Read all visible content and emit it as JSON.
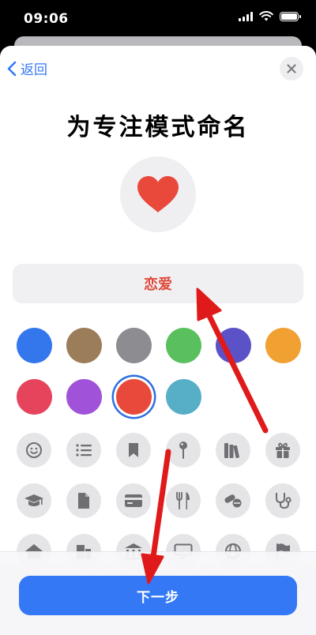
{
  "status_bar": {
    "time": "09:06"
  },
  "nav": {
    "back_label": "返回"
  },
  "title": "为专注模式命名",
  "focus_name": {
    "value": "恋爱",
    "selected_icon": "heart-icon"
  },
  "colors": {
    "selected": "#e8493b",
    "swatches": [
      "#3477ec",
      "#9b7d5a",
      "#8c8c91",
      "#5ac05e",
      "#5c52c8",
      "#f1a032",
      "#e6445c",
      "#a052d8",
      "#e8493b",
      "#57aec7"
    ]
  },
  "symbols": [
    "smiley-icon",
    "list-icon",
    "bookmark-icon",
    "pin-icon",
    "books-icon",
    "gift-icon",
    "graduation-cap-icon",
    "document-icon",
    "credit-card-icon",
    "fork-knife-icon",
    "pills-icon",
    "stethoscope-icon",
    "house-icon",
    "building-icon",
    "bank-icon",
    "monitor-icon",
    "globe-icon",
    "flag-icon"
  ],
  "footer": {
    "next_label": "下一步"
  },
  "accent": "#3478f6"
}
